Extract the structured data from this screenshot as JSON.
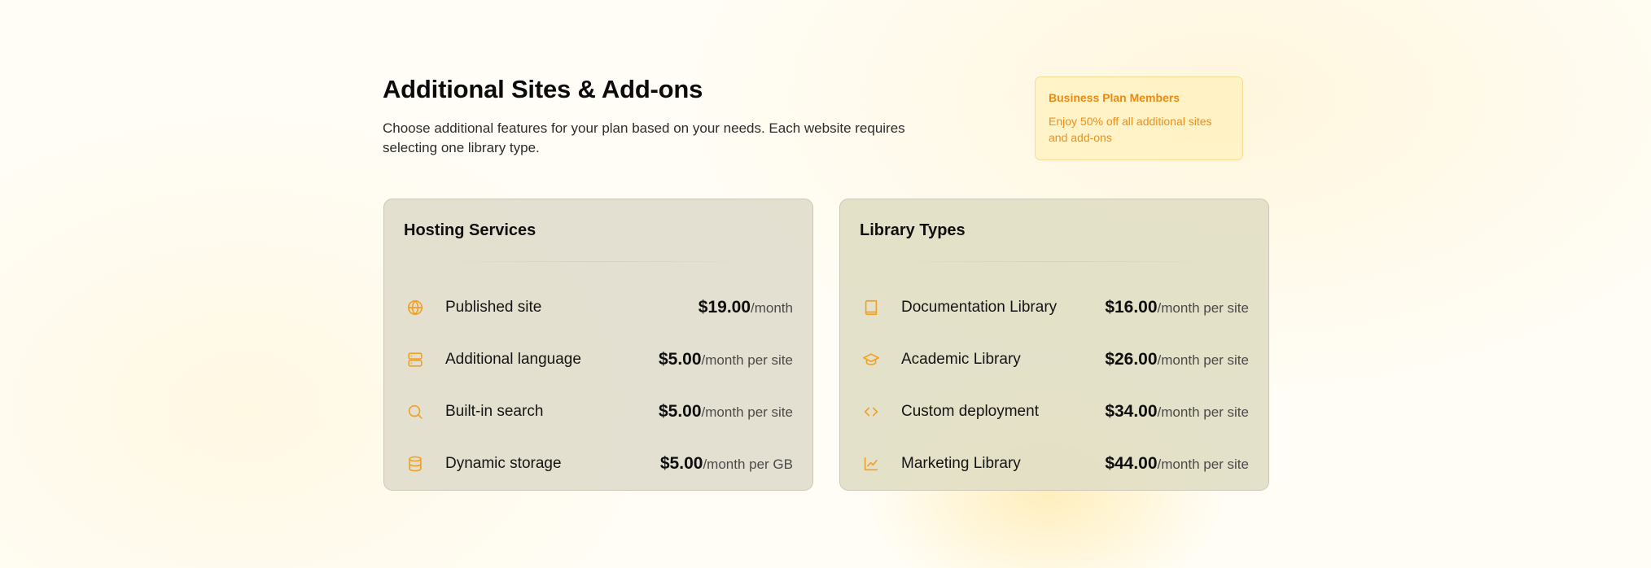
{
  "header": {
    "title": "Additional Sites & Add-ons",
    "subtitle": "Choose additional features for your plan based on your needs. Each website requires selecting one library type."
  },
  "promo": {
    "title": "Business Plan Members",
    "text": "Enjoy 50% off all additional sites and add-ons"
  },
  "colors": {
    "accent": "#f0a126",
    "promo_text": "#ea8a12",
    "card_bg": "#e2ddcd"
  },
  "hosting": {
    "title": "Hosting Services",
    "items": [
      {
        "icon": "globe-icon",
        "label": "Published site",
        "price": "$19.00",
        "unit": "/month"
      },
      {
        "icon": "server-icon",
        "label": "Additional language",
        "price": "$5.00",
        "unit": "/month per site"
      },
      {
        "icon": "search-icon",
        "label": "Built-in search",
        "price": "$5.00",
        "unit": "/month per site"
      },
      {
        "icon": "database-icon",
        "label": "Dynamic storage",
        "price": "$5.00",
        "unit": "/month per GB"
      }
    ]
  },
  "libraries": {
    "title": "Library Types",
    "items": [
      {
        "icon": "book-icon",
        "label": "Documentation Library",
        "price": "$16.00",
        "unit": "/month per site"
      },
      {
        "icon": "graduation-cap-icon",
        "label": "Academic Library",
        "price": "$26.00",
        "unit": "/month per site"
      },
      {
        "icon": "code-icon",
        "label": "Custom deployment",
        "price": "$34.00",
        "unit": "/month per site"
      },
      {
        "icon": "line-chart-icon",
        "label": "Marketing Library",
        "price": "$44.00",
        "unit": "/month per site"
      }
    ]
  }
}
